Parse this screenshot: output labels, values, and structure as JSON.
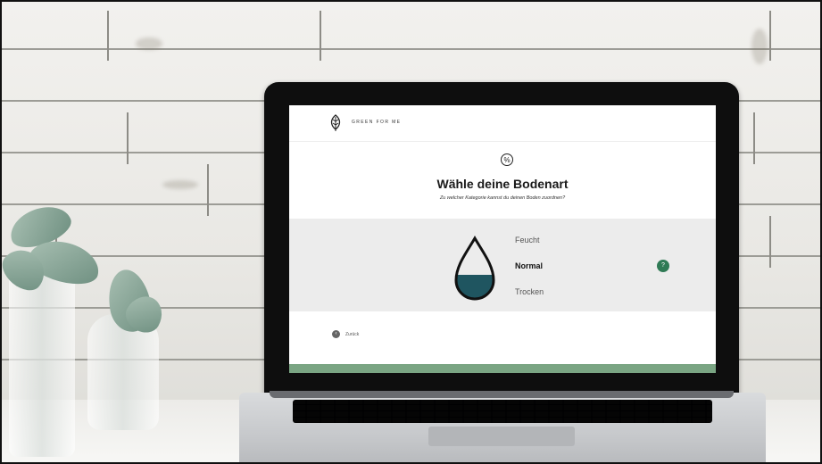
{
  "app": {
    "brand": "GREEN FOR ME"
  },
  "step": {
    "badge": "%"
  },
  "heading": {
    "title": "Wähle deine Bodenart",
    "subtitle": "Zu welcher Kategorie kannst du deinen Boden zuordnen?"
  },
  "soil_options": {
    "items": [
      {
        "label": "Feucht",
        "selected": false
      },
      {
        "label": "Normal",
        "selected": true
      },
      {
        "label": "Trocken",
        "selected": false
      }
    ],
    "help_icon": "question-icon"
  },
  "nav": {
    "back_label": "Zurück",
    "back_icon": "chevron-left-icon"
  },
  "colors": {
    "accent": "#2f7a55",
    "drop_fill": "#1f5560",
    "bottom_bar": "#7aa583"
  }
}
